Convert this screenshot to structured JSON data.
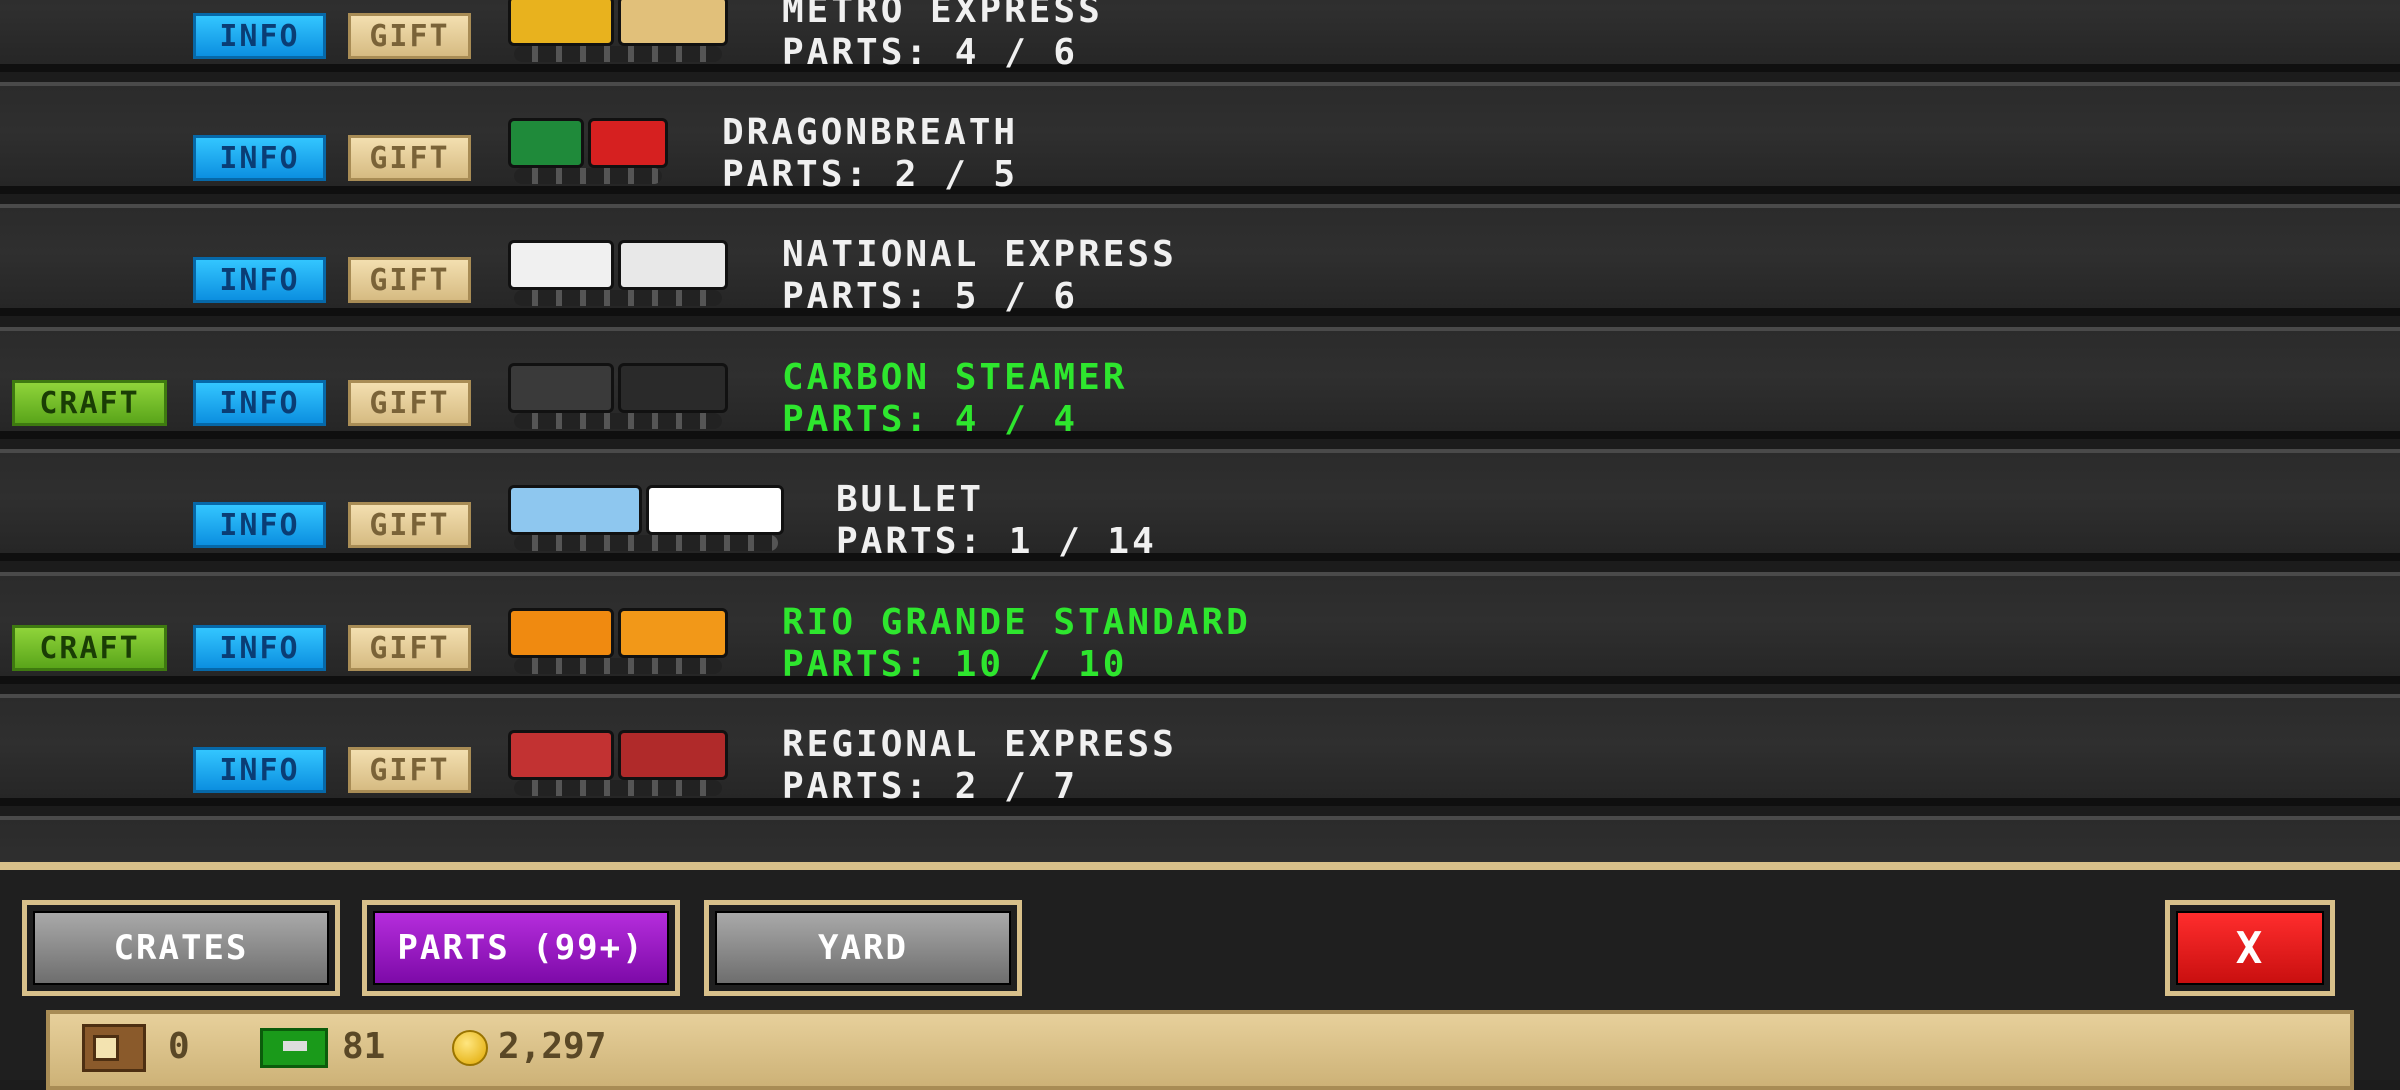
{
  "buttons": {
    "craft": "CRAFT",
    "info": "INFO",
    "gift": "GIFT"
  },
  "trains": [
    {
      "name": "METRO EXPRESS",
      "parts": "PARTS: 4 / 6",
      "complete": false,
      "craftable": false,
      "colors": [
        "#e8b21e",
        "#e1c07a"
      ]
    },
    {
      "name": "DRAGONBREATH",
      "parts": "PARTS: 2 / 5",
      "complete": false,
      "craftable": false,
      "colors": [
        "#1f8a3a",
        "#d62020"
      ]
    },
    {
      "name": "NATIONAL EXPRESS",
      "parts": "PARTS: 5 / 6",
      "complete": false,
      "craftable": false,
      "colors": [
        "#f0f0f0",
        "#e8e8e8"
      ]
    },
    {
      "name": "CARBON STEAMER",
      "parts": "PARTS: 4 / 4",
      "complete": true,
      "craftable": true,
      "colors": [
        "#3a3a3a",
        "#2a2a2a"
      ]
    },
    {
      "name": "BULLET",
      "parts": "PARTS: 1 / 14",
      "complete": false,
      "craftable": false,
      "colors": [
        "#8ec7ef",
        "#ffffff"
      ]
    },
    {
      "name": "RIO GRANDE STANDARD",
      "parts": "PARTS: 10 / 10",
      "complete": true,
      "craftable": true,
      "colors": [
        "#f08a10",
        "#f29818"
      ]
    },
    {
      "name": "REGIONAL EXPRESS",
      "parts": "PARTS: 2 / 7",
      "complete": false,
      "craftable": false,
      "colors": [
        "#c23232",
        "#b02a2a"
      ]
    }
  ],
  "tabs": {
    "crates": "CRATES",
    "parts": "PARTS (99+)",
    "yard": "YARD",
    "close": "X"
  },
  "status": {
    "crates": "0",
    "cash": "81",
    "coins": "2,297"
  }
}
